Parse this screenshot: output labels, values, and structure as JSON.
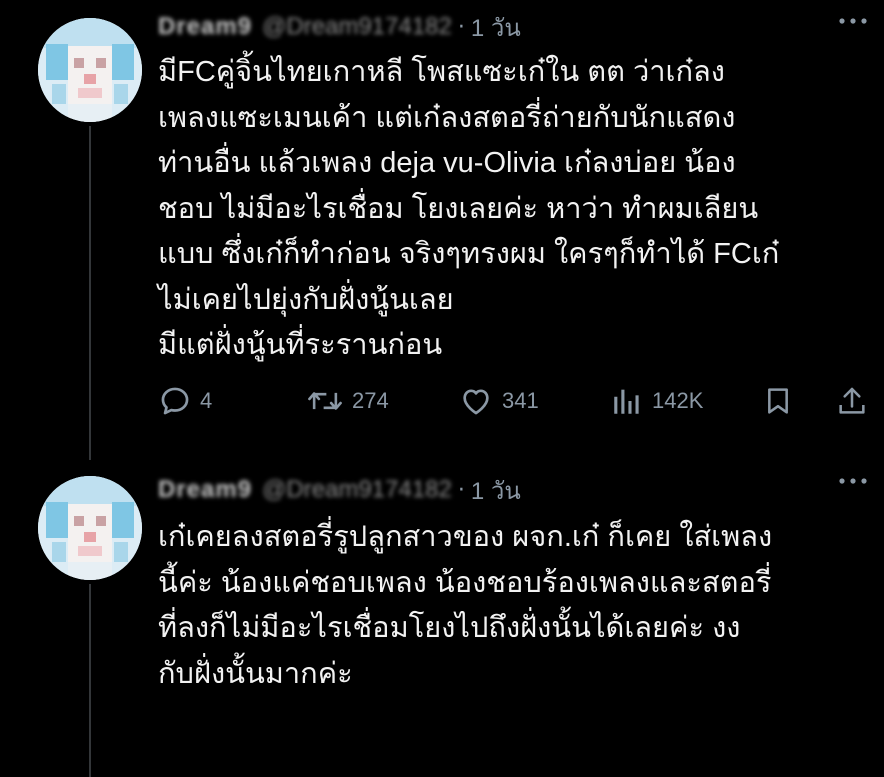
{
  "tweets": [
    {
      "display_name": "Dream9",
      "handle": "@Dream9174182",
      "separator": "·",
      "time": "1 วัน",
      "body_lines": [
        "มีFCคู่จิ้นไทยเกาหลี โพสแซะเก๋ใน ตต ว่าเก๋ลง",
        "เพลงแซะเมนเค้า แต่เก๋ลงสตอรี่ถ่ายกับนักแสดง",
        "ท่านอื่น แล้วเพลง deja vu-Olivia เก๋ลงบ่อย น้อง",
        "ชอบ ไม่มีอะไรเชื่อม โยงเลยค่ะ หาว่า ทำผมเลียน",
        "แบบ ซึ่งเก๋ก็ทำก่อน จริงๆทรงผม ใครๆก็ทำได้ FCเก๋",
        "ไม่เคยไปยุ่งกับฝั่งนู้นเลย",
        "มีแต่ฝั่งนู้นที่ระรานก่อน"
      ],
      "actions": {
        "replies": "4",
        "retweets": "274",
        "likes": "341",
        "views": "142K"
      }
    },
    {
      "display_name": "Dream9",
      "handle": "@Dream9174182",
      "separator": "·",
      "time": "1 วัน",
      "body_lines": [
        "เก๋เคยลงสตอรี่รูปลูกสาวของ ผจก.เก๋ ก็เคย ใส่เพลง",
        "นี้ค่ะ น้องแค่ชอบเพลง น้องชอบร้องเพลงและสตอรี่",
        "ที่ลงก็ไม่มีอะไรเชื่อมโยงไปถึงฝั่งนั้นได้เลยค่ะ งง",
        "กับฝั่งนั้นมากค่ะ"
      ]
    }
  ],
  "icons": {
    "more": "more-dots-icon",
    "reply": "reply-bubble-icon",
    "retweet": "retweet-icon",
    "like": "heart-icon",
    "views": "views-bar-chart-icon",
    "bookmark": "bookmark-icon",
    "share": "share-upload-icon"
  },
  "colors": {
    "background": "#000000",
    "text": "#f2f2f2",
    "muted": "#8b98a5",
    "avatar_bg": "#d9ecf6"
  }
}
